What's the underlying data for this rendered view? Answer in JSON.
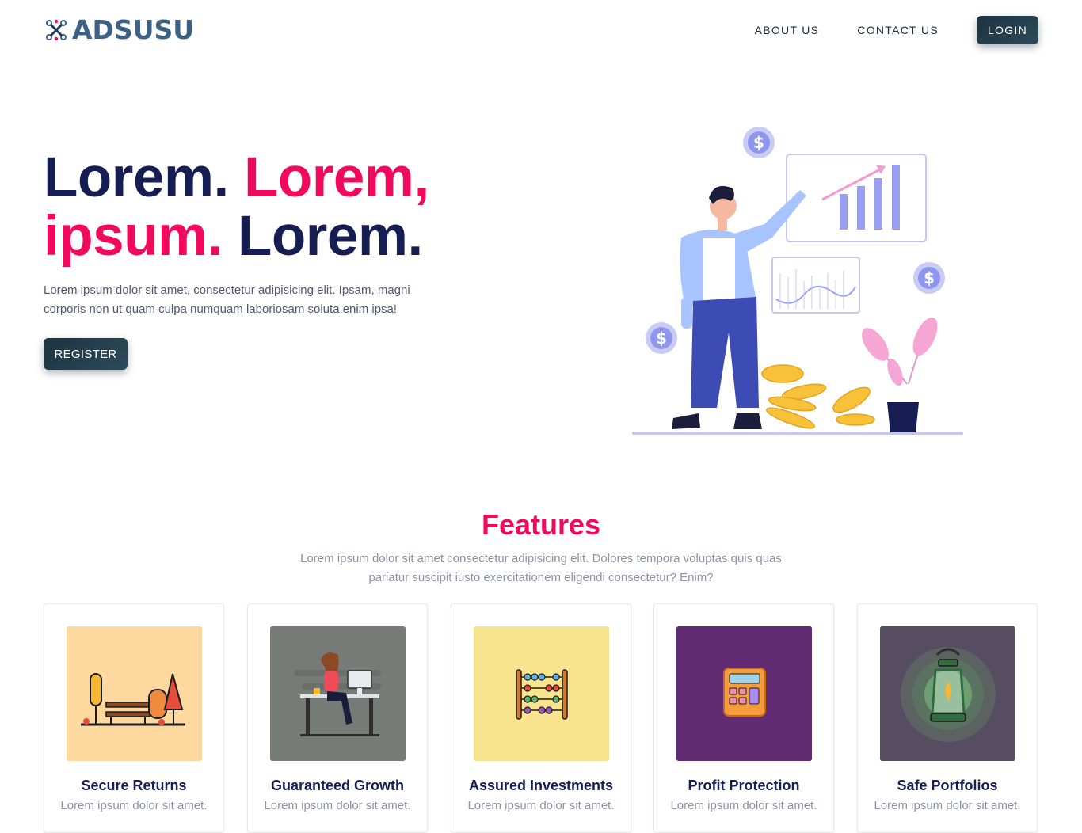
{
  "brand": {
    "name": "ADSUSU",
    "primary_color": "#3d6185",
    "accent": "#f0095d",
    "dark": "#161d52"
  },
  "nav": {
    "about_label": "ABOUT US",
    "contact_label": "CONTACT US",
    "login_label": "LOGIN"
  },
  "hero": {
    "title_part1": "Lorem. ",
    "title_part2": "Lorem,",
    "title_part3": "ipsum.",
    "title_part4": " Lorem.",
    "description": "Lorem ipsum dolor sit amet, consectetur adipisicing elit. Ipsam, magni corporis non ut quam culpa numquam laboriosam soluta enim ipsa!",
    "register_label": "REGISTER",
    "illustration_icon": "businessman-growth-chart-illustration"
  },
  "features": {
    "title": "Features",
    "description": "Lorem ipsum dolor sit amet consectetur adipisicing elit. Dolores tempora voluptas quis quas pariatur suscipit iusto exercitationem eligendi consectetur? Enim?",
    "cards": [
      {
        "title": "Secure Returns",
        "text": "Lorem ipsum dolor sit amet.",
        "icon": "park-bench-icon",
        "bg": "#fdd9a0"
      },
      {
        "title": "Guaranteed Growth",
        "text": "Lorem ipsum dolor sit amet.",
        "icon": "woman-at-desk-icon",
        "bg": "#767b77"
      },
      {
        "title": "Assured Investments",
        "text": "Lorem ipsum dolor sit amet.",
        "icon": "abacus-icon",
        "bg": "#f8e48e"
      },
      {
        "title": "Profit Protection",
        "text": "Lorem ipsum dolor sit amet.",
        "icon": "calculator-icon",
        "bg": "#612b74"
      },
      {
        "title": "Safe Portfolios",
        "text": "Lorem ipsum dolor sit amet.",
        "icon": "lantern-icon",
        "bg": "#574d62"
      }
    ]
  }
}
